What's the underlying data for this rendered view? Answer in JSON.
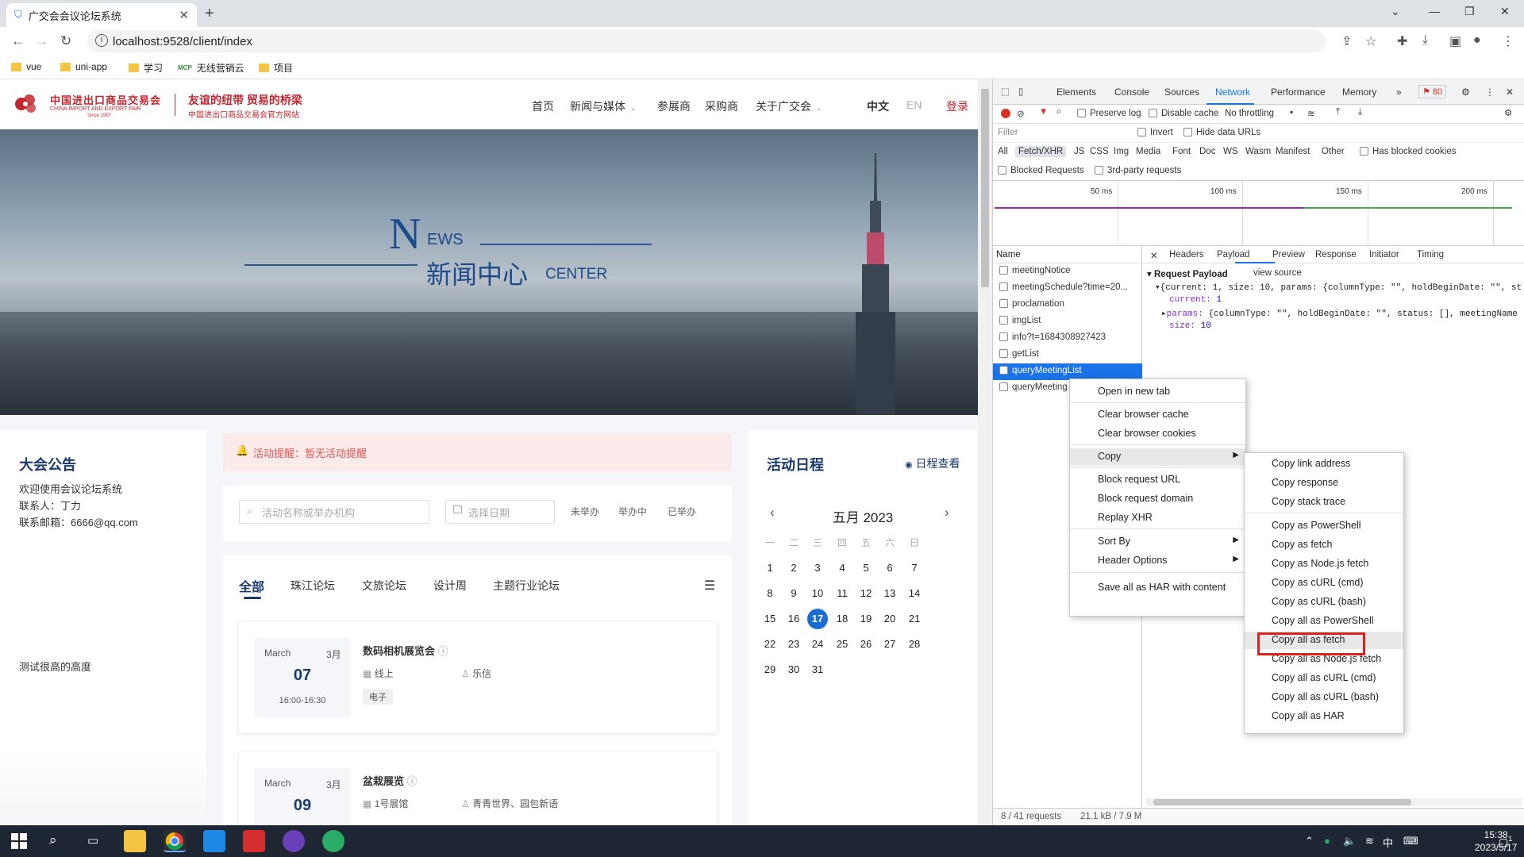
{
  "browser": {
    "tab_title": "广交会会议论坛系统",
    "url": "localhost:9528/client/index",
    "bookmarks": [
      "vue",
      "uni-app",
      "学习",
      "无线营销云",
      "项目"
    ]
  },
  "site": {
    "logo_cn": "中国进出口商品交易会",
    "logo_en": "CHINA IMPORT AND EXPORT FAIR",
    "logo_since": "Since 1957",
    "slogan_main": "友谊的纽带 贸易的桥梁",
    "slogan_sub": "中国进出口商品交易会官方网站",
    "nav": [
      "首页",
      "新闻与媒体",
      "参展商",
      "采购商",
      "关于广交会"
    ],
    "lang_cn": "中文",
    "lang_en": "EN",
    "login": "登录",
    "banner": {
      "n": "N",
      "ews": "EWS",
      "cn": "新闻中心",
      "center": "CENTER"
    }
  },
  "notice": {
    "title": "大会公告",
    "welcome": "欢迎使用会议论坛系统",
    "contact": "联系人：丁力",
    "email": "联系邮箱：6666@qq.com",
    "test": "测试很高的高度"
  },
  "alert": {
    "text": "活动提醒：暂无活动提醒"
  },
  "filters": {
    "search_placeholder": "活动名称或举办机构",
    "date_placeholder": "选择日期",
    "statuses": [
      "未举办",
      "举办中",
      "已举办"
    ]
  },
  "categories": [
    "全部",
    "珠江论坛",
    "文旅论坛",
    "设计周",
    "主题行业论坛"
  ],
  "events": [
    {
      "month_en": "March",
      "month_cn": "3月",
      "day": "07",
      "time": "16:00-16:30",
      "title": "数码相机展览会",
      "location": "线上",
      "host": "乐信",
      "tag": "电子"
    },
    {
      "month_en": "March",
      "month_cn": "3月",
      "day": "09",
      "time": "",
      "title": "盆栽展览",
      "location": "1号展馆",
      "host": "青青世界、园包新语",
      "tag": ""
    }
  ],
  "calendar": {
    "title": "活动日程",
    "view_link": "日程查看",
    "month_label": "五月 2023",
    "weekdays": [
      "一",
      "二",
      "三",
      "四",
      "五",
      "六",
      "日"
    ],
    "today": 17,
    "days_in_month": 31
  },
  "devtools": {
    "tabs": [
      "Elements",
      "Console",
      "Sources",
      "Network",
      "Performance",
      "Memory"
    ],
    "errors": "80",
    "throttle": "No throttling",
    "preserve_log": "Preserve log",
    "disable_cache": "Disable cache",
    "filter_placeholder": "Filter",
    "invert": "Invert",
    "hide_data_urls": "Hide data URLs",
    "types": [
      "All",
      "Fetch/XHR",
      "JS",
      "CSS",
      "Img",
      "Media",
      "Font",
      "Doc",
      "WS",
      "Wasm",
      "Manifest",
      "Other"
    ],
    "has_blocked_cookies": "Has blocked cookies",
    "blocked_requests": "Blocked Requests",
    "third_party": "3rd-party requests",
    "timeline_ticks": [
      "50 ms",
      "100 ms",
      "150 ms",
      "200 ms"
    ],
    "name_header": "Name",
    "requests": [
      "meetingNotice",
      "meetingSchedule?time=20...",
      "proclamation",
      "imgList",
      "info?t=1684308927423",
      "getList",
      "queryMeetingList",
      "queryMeeting"
    ],
    "selected_request": 6,
    "detail_tabs": [
      "Headers",
      "Payload",
      "Preview",
      "Response",
      "Initiator",
      "Timing"
    ],
    "payload_title": "Request Payload",
    "view_source": "view source",
    "payload_summary": "{current: 1, size: 10, params: {columnType: \"\", holdBeginDate: \"\", st",
    "payload_current": "1",
    "payload_params": "{columnType: \"\", holdBeginDate: \"\", status: [], meetingName",
    "payload_size": "10",
    "status_requests": "8 / 41 requests",
    "status_size": "21.1 kB / 7.9 M"
  },
  "context_menu": [
    "Open in new tab",
    "Clear browser cache",
    "Clear browser cookies",
    "Copy",
    "Block request URL",
    "Block request domain",
    "Replay XHR",
    "Sort By",
    "Header Options",
    "Save all as HAR with content"
  ],
  "copy_submenu": [
    "Copy link address",
    "Copy response",
    "Copy stack trace",
    "Copy as PowerShell",
    "Copy as fetch",
    "Copy as Node.js fetch",
    "Copy as cURL (cmd)",
    "Copy as cURL (bash)",
    "Copy all as PowerShell",
    "Copy all as fetch",
    "Copy all as Node.js fetch",
    "Copy all as cURL (cmd)",
    "Copy all as cURL (bash)",
    "Copy all as HAR"
  ],
  "taskbar": {
    "time": "15:38",
    "date": "2023/5/17",
    "ime": "中",
    "notif": "1"
  },
  "colors": {
    "brand_red": "#c3262e",
    "navy": "#1a3a6e",
    "devtools_blue": "#1a73e8",
    "highlight_box": "#e02020"
  }
}
